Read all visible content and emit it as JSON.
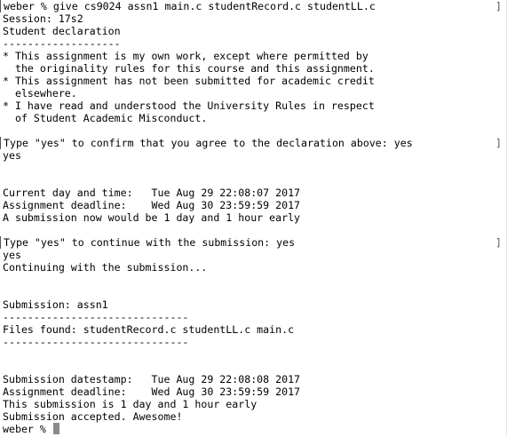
{
  "terminal": {
    "cursor_color": "#8a8a8a",
    "text_color": "#000000",
    "background": "#ffffff",
    "right_bracket": "]",
    "lines": [
      {
        "text": "weber % give cs9024 assn1 main.c studentRecord.c studentLL.c",
        "boxed": true
      },
      {
        "text": "Session: 17s2"
      },
      {
        "text": "Student declaration"
      },
      {
        "text": "-------------------"
      },
      {
        "text": "* This assignment is my own work, except where permitted by"
      },
      {
        "text": "  the originality rules for this course and this assignment."
      },
      {
        "text": "* This assignment has not been submitted for academic credit"
      },
      {
        "text": "  elsewhere."
      },
      {
        "text": "* I have read and understood the University Rules in respect"
      },
      {
        "text": "  of Student Academic Misconduct."
      },
      {
        "text": ""
      },
      {
        "text": "Type \"yes\" to confirm that you agree to the declaration above: yes",
        "boxed": true
      },
      {
        "text": "yes"
      },
      {
        "text": ""
      },
      {
        "text": ""
      },
      {
        "text": "Current day and time:   Tue Aug 29 22:08:07 2017"
      },
      {
        "text": "Assignment deadline:    Wed Aug 30 23:59:59 2017"
      },
      {
        "text": "A submission now would be 1 day and 1 hour early"
      },
      {
        "text": ""
      },
      {
        "text": "Type \"yes\" to continue with the submission: yes",
        "boxed": true
      },
      {
        "text": "yes"
      },
      {
        "text": "Continuing with the submission..."
      },
      {
        "text": ""
      },
      {
        "text": ""
      },
      {
        "text": "Submission: assn1"
      },
      {
        "text": "------------------------------"
      },
      {
        "text": "Files found: studentRecord.c studentLL.c main.c"
      },
      {
        "text": "------------------------------"
      },
      {
        "text": ""
      },
      {
        "text": ""
      },
      {
        "text": "Submission datestamp:   Tue Aug 29 22:08:08 2017"
      },
      {
        "text": "Assignment deadline:    Wed Aug 30 23:59:59 2017"
      },
      {
        "text": "This submission is 1 day and 1 hour early"
      },
      {
        "text": "Submission accepted. Awesome!"
      },
      {
        "text": "weber % ",
        "prompt": true
      }
    ]
  }
}
